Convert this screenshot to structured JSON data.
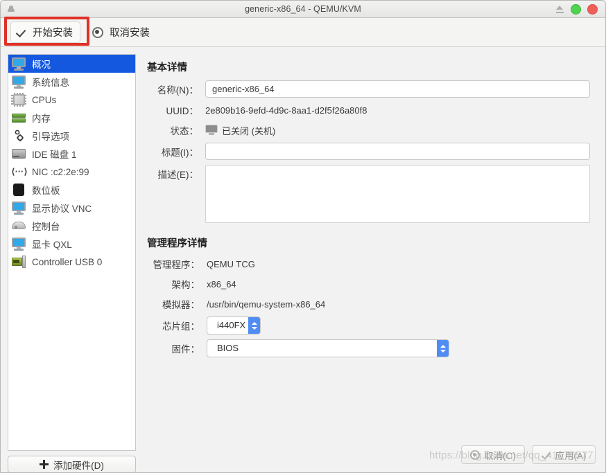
{
  "window": {
    "title": "generic-x86_64 - QEMU/KVM",
    "app_icon": "vm-app-icon",
    "controls": {
      "eject": "eject-icon",
      "minimize_color": "#4fd24f",
      "close_color": "#ef5f5a"
    }
  },
  "toolbar": {
    "begin_install_label": "开始安装",
    "cancel_install_label": "取消安装",
    "annotation_color": "#e03127"
  },
  "sidebar": {
    "items": [
      {
        "label": "概况",
        "icon": "monitor-icon",
        "selected": true
      },
      {
        "label": "系统信息",
        "icon": "monitor-icon",
        "selected": false
      },
      {
        "label": "CPUs",
        "icon": "cpu-icon",
        "selected": false
      },
      {
        "label": "内存",
        "icon": "memory-icon",
        "selected": false
      },
      {
        "label": "引导选项",
        "icon": "gear-icon",
        "selected": false
      },
      {
        "label": "IDE 磁盘 1",
        "icon": "disk-icon",
        "selected": false
      },
      {
        "label": "NIC :c2:2e:99",
        "icon": "network-icon",
        "selected": false
      },
      {
        "label": "数位板",
        "icon": "tablet-icon",
        "selected": false
      },
      {
        "label": "显示协议 VNC",
        "icon": "monitor-icon",
        "selected": false
      },
      {
        "label": "控制台",
        "icon": "console-icon",
        "selected": false
      },
      {
        "label": "显卡 QXL",
        "icon": "monitor-icon",
        "selected": false
      },
      {
        "label": "Controller USB 0",
        "icon": "usb-controller-icon",
        "selected": false
      }
    ],
    "add_hardware_label": "添加硬件(D)",
    "selected_bg": "#1458e0"
  },
  "basic_details": {
    "heading": "基本详情",
    "name_label": "名称(N)：",
    "name_value": "generic-x86_64",
    "uuid_label": "UUID：",
    "uuid_value": "2e809b16-9efd-4d9c-8aa1-d2f5f26a80f8",
    "state_label": "状态：",
    "state_value": "已关闭 (关机)",
    "state_icon": "shutoff-monitor-icon",
    "title_label": "标题(I)：",
    "title_value": "",
    "desc_label": "描述(E)：",
    "desc_value": ""
  },
  "hypervisor_details": {
    "heading": "管理程序详情",
    "hypervisor_label": "管理程序：",
    "hypervisor_value": "QEMU TCG",
    "arch_label": "架构：",
    "arch_value": "x86_64",
    "emulator_label": "模拟器：",
    "emulator_value": "/usr/bin/qemu-system-x86_64",
    "chipset_label": "芯片组：",
    "chipset_value": "i440FX",
    "firmware_label": "固件：",
    "firmware_value": "BIOS",
    "dropdown_arrow_color": "#4f8df5"
  },
  "footer": {
    "cancel_label": "取消(C)",
    "apply_label": "应用(A)"
  },
  "watermark": "https://blog.csdn.net/qq_41676577"
}
